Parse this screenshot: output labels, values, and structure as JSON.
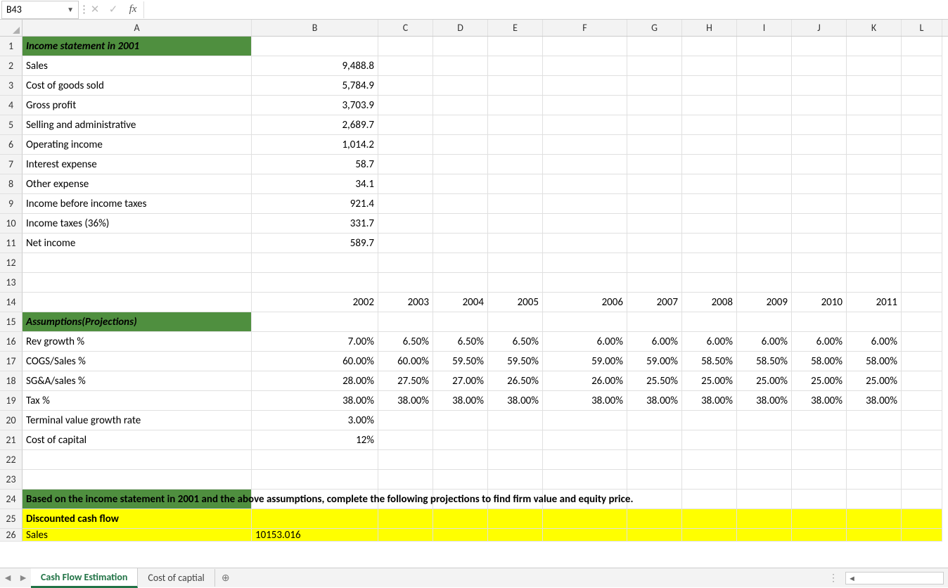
{
  "nameBox": "B43",
  "formula": "",
  "columns": [
    "A",
    "B",
    "C",
    "D",
    "E",
    "F",
    "G",
    "H",
    "I",
    "J",
    "K",
    "L"
  ],
  "colClasses": [
    "cA",
    "cB",
    "cC",
    "cD",
    "cE",
    "cF",
    "cG",
    "cH",
    "cI",
    "cJ",
    "cK",
    "cL"
  ],
  "highlightRows": {
    "1": "hdr-green",
    "15": "hdr-green",
    "24": "hdr-green2",
    "25": "yellow",
    "26": "yellow"
  },
  "rows": [
    {
      "n": 1,
      "cells": {
        "A": "Income statement in 2001"
      }
    },
    {
      "n": 2,
      "cells": {
        "A": "Sales",
        "B": "9,488.8"
      }
    },
    {
      "n": 3,
      "cells": {
        "A": "Cost of goods sold",
        "B": "5,784.9"
      }
    },
    {
      "n": 4,
      "cells": {
        "A": "Gross profit",
        "B": "3,703.9"
      }
    },
    {
      "n": 5,
      "cells": {
        "A": "Selling and administrative",
        "B": "2,689.7"
      }
    },
    {
      "n": 6,
      "cells": {
        "A": "Operating income",
        "B": "1,014.2"
      }
    },
    {
      "n": 7,
      "cells": {
        "A": "Interest expense",
        "B": "58.7"
      }
    },
    {
      "n": 8,
      "cells": {
        "A": "Other expense",
        "B": "34.1"
      }
    },
    {
      "n": 9,
      "cells": {
        "A": "Income before income taxes",
        "B": "921.4"
      }
    },
    {
      "n": 10,
      "cells": {
        "A": "Income taxes (36%)",
        "B": "331.7"
      }
    },
    {
      "n": 11,
      "cells": {
        "A": "Net income",
        "B": "589.7"
      }
    },
    {
      "n": 12,
      "cells": {}
    },
    {
      "n": 13,
      "cells": {}
    },
    {
      "n": 14,
      "cells": {
        "B": "2002",
        "C": "2003",
        "D": "2004",
        "E": "2005",
        "F": "2006",
        "G": "2007",
        "H": "2008",
        "I": "2009",
        "J": "2010",
        "K": "2011"
      }
    },
    {
      "n": 15,
      "cells": {
        "A": "Assumptions(Projections)"
      }
    },
    {
      "n": 16,
      "cells": {
        "A": "Rev growth %",
        "B": "7.00%",
        "C": "6.50%",
        "D": "6.50%",
        "E": "6.50%",
        "F": "6.00%",
        "G": "6.00%",
        "H": "6.00%",
        "I": "6.00%",
        "J": "6.00%",
        "K": "6.00%"
      }
    },
    {
      "n": 17,
      "cells": {
        "A": "COGS/Sales %",
        "B": "60.00%",
        "C": "60.00%",
        "D": "59.50%",
        "E": "59.50%",
        "F": "59.00%",
        "G": "59.00%",
        "H": "58.50%",
        "I": "58.50%",
        "J": "58.00%",
        "K": "58.00%"
      }
    },
    {
      "n": 18,
      "cells": {
        "A": "SG&A/sales %",
        "B": "28.00%",
        "C": "27.50%",
        "D": "27.00%",
        "E": "26.50%",
        "F": "26.00%",
        "G": "25.50%",
        "H": "25.00%",
        "I": "25.00%",
        "J": "25.00%",
        "K": "25.00%"
      }
    },
    {
      "n": 19,
      "cells": {
        "A": "Tax %",
        "B": "38.00%",
        "C": "38.00%",
        "D": "38.00%",
        "E": "38.00%",
        "F": "38.00%",
        "G": "38.00%",
        "H": "38.00%",
        "I": "38.00%",
        "J": "38.00%",
        "K": "38.00%"
      }
    },
    {
      "n": 20,
      "cells": {
        "A": "Terminal value growth rate",
        "B": "3.00%"
      }
    },
    {
      "n": 21,
      "cells": {
        "A": "Cost of capital",
        "B": "12%"
      }
    },
    {
      "n": 22,
      "cells": {}
    },
    {
      "n": 23,
      "cells": {}
    },
    {
      "n": 24,
      "cells": {
        "A": "Based on the income statement in 2001 and the above assumptions, complete the following projections to find firm value and equity price."
      }
    },
    {
      "n": 25,
      "cells": {
        "A": "Discounted cash flow"
      }
    },
    {
      "n": 26,
      "cells": {
        "A": "Sales",
        "B": "10153.016"
      }
    }
  ],
  "boldOverflowRows": [
    24
  ],
  "yellowSpanRows": [
    25,
    26
  ],
  "tabs": {
    "active": "Cash Flow Estimation",
    "others": [
      "Cost of captial"
    ]
  }
}
